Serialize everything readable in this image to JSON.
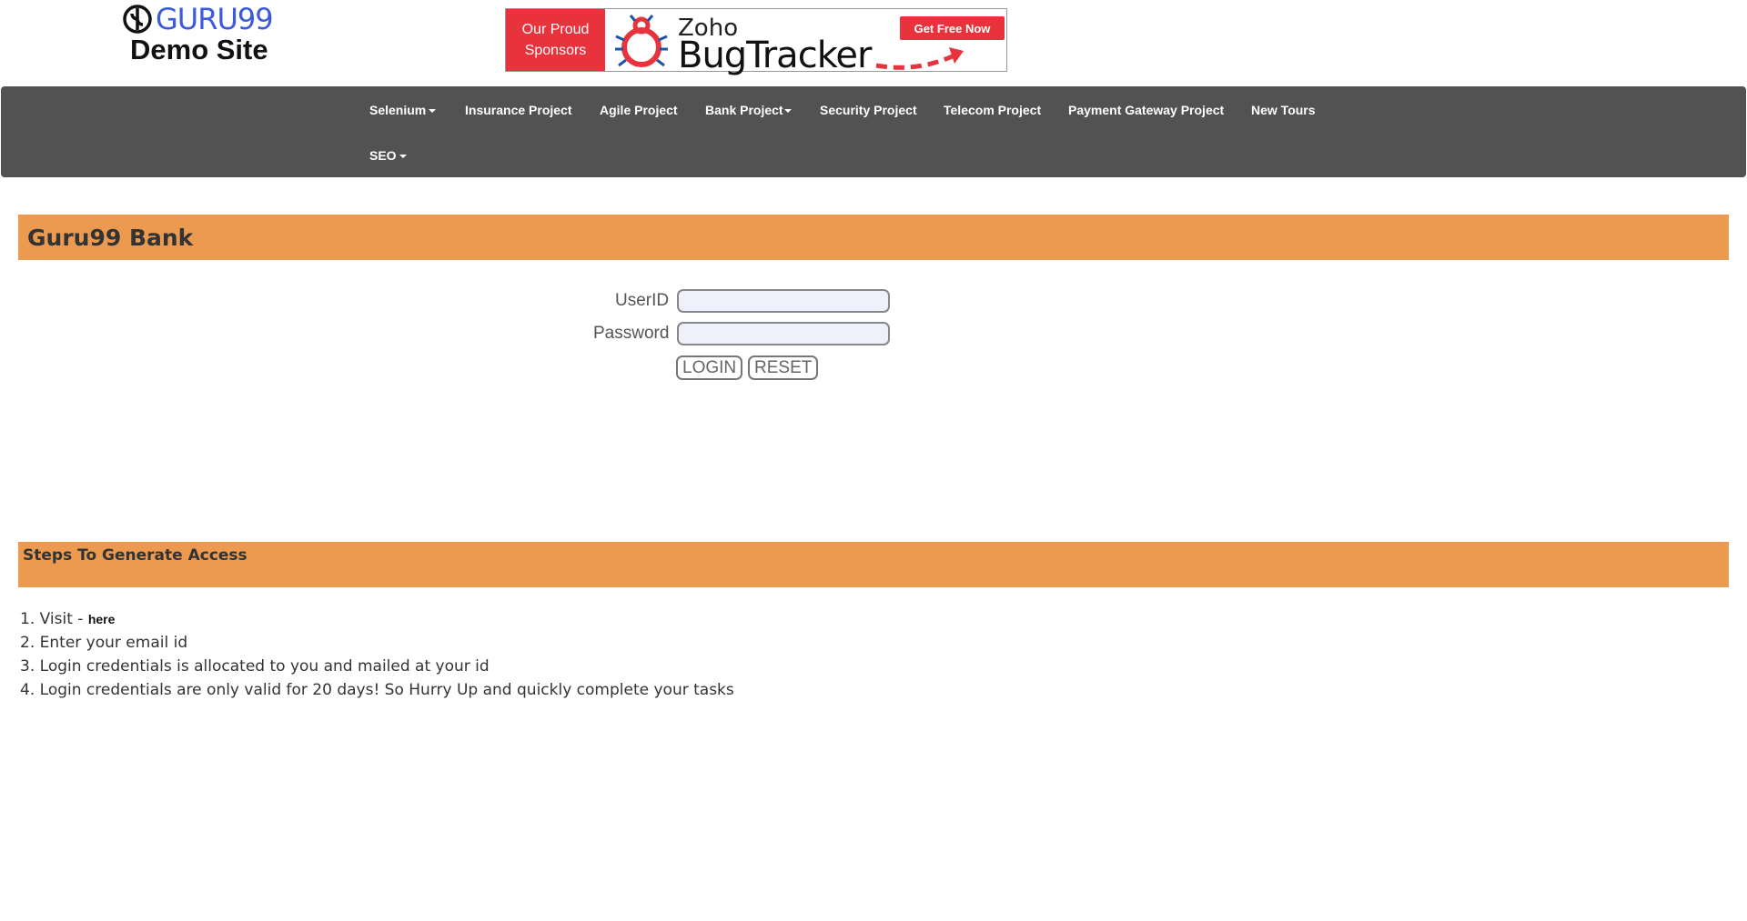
{
  "logo": {
    "brand": "GURU99",
    "subtitle": "Demo Site"
  },
  "banner": {
    "left_line1": "Our Proud",
    "left_line2": "Sponsors",
    "company": "Zoho",
    "product": "BugTracker",
    "cta": "Get Free Now"
  },
  "nav": {
    "items": [
      {
        "label": "Selenium",
        "dropdown": true
      },
      {
        "label": "Insurance Project",
        "dropdown": false
      },
      {
        "label": "Agile Project",
        "dropdown": false
      },
      {
        "label": "Bank Project",
        "dropdown": true
      },
      {
        "label": "Security Project",
        "dropdown": false
      },
      {
        "label": "Telecom Project",
        "dropdown": false
      },
      {
        "label": "Payment Gateway Project",
        "dropdown": false
      },
      {
        "label": "New Tours",
        "dropdown": false
      },
      {
        "label": "SEO",
        "dropdown": true
      }
    ]
  },
  "page": {
    "title": "Guru99 Bank"
  },
  "form": {
    "userid_label": "UserID",
    "password_label": "Password",
    "userid_value": "",
    "password_value": "",
    "login_label": "LOGIN",
    "reset_label": "RESET"
  },
  "steps": {
    "title": "Steps To Generate Access",
    "items": [
      {
        "number": "1.",
        "text": "Visit - ",
        "link": "here"
      },
      {
        "number": "2.",
        "text": "Enter your email id"
      },
      {
        "number": "3.",
        "text": "Login credentials is allocated to you and mailed at your id"
      },
      {
        "number": "4.",
        "text": "Login credentials are only valid for 20 days! So Hurry Up and quickly complete your tasks"
      }
    ]
  },
  "colors": {
    "navbar": "#525252",
    "section_bar": "#eb9a4f",
    "brand_blue": "#3b5bdb",
    "sponsor_red": "#e8323c"
  }
}
